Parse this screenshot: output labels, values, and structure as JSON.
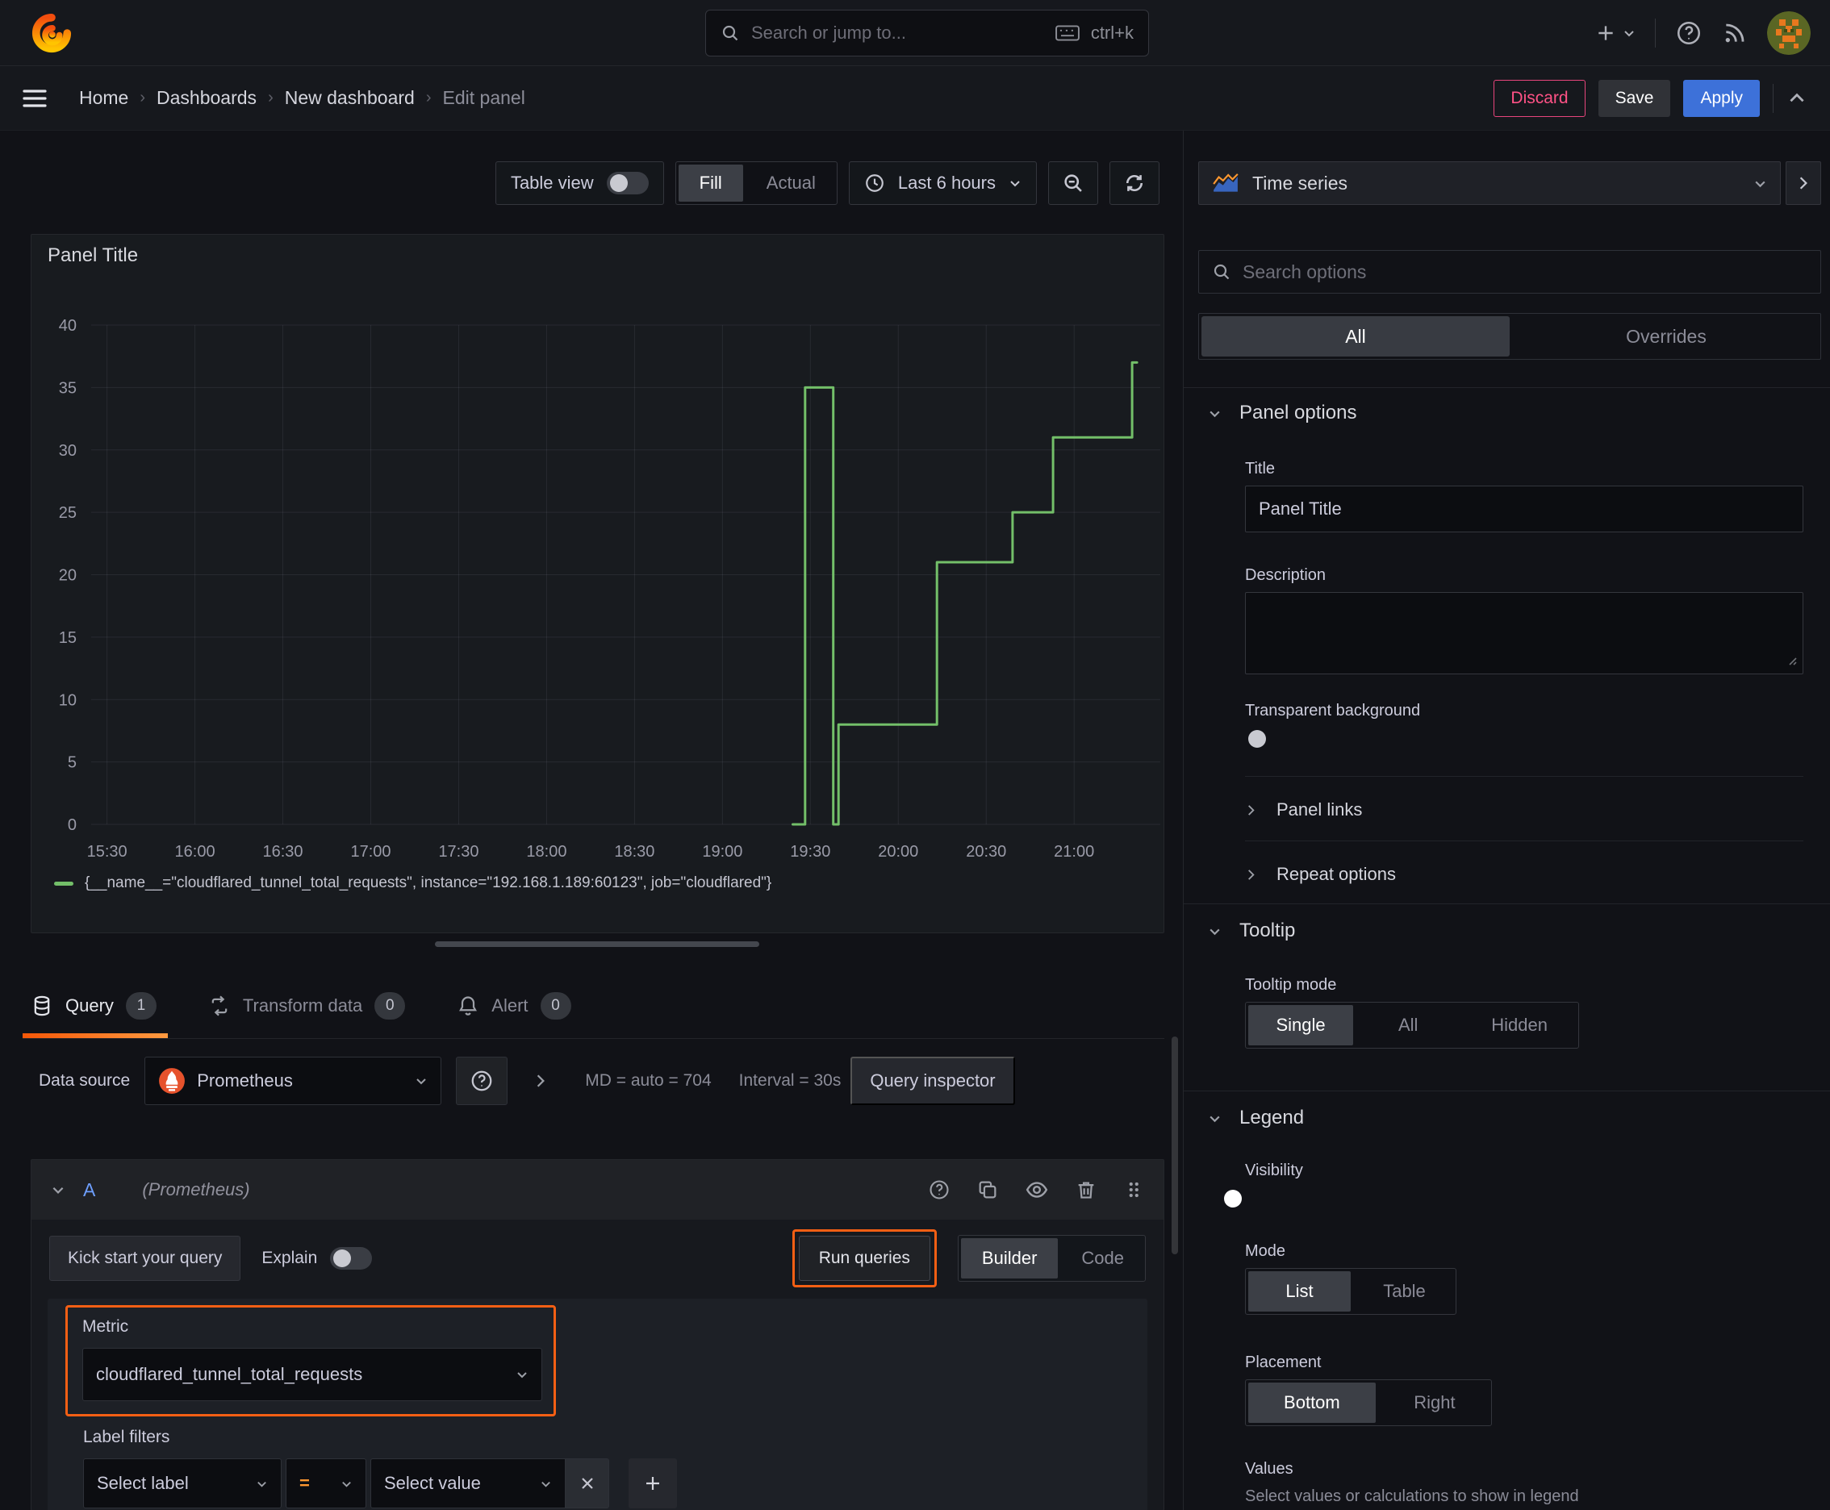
{
  "topbar": {
    "search_placeholder": "Search or jump to...",
    "shortcut": "ctrl+k"
  },
  "breadcrumb": {
    "items": [
      "Home",
      "Dashboards",
      "New dashboard",
      "Edit panel"
    ]
  },
  "actions": {
    "discard": "Discard",
    "save": "Save",
    "apply": "Apply"
  },
  "view_toolbar": {
    "table_view": "Table view",
    "fill": "Fill",
    "actual": "Actual",
    "time_range": "Last 6 hours"
  },
  "panel": {
    "title": "Panel Title"
  },
  "chart_data": {
    "type": "line",
    "line_style": "step-after",
    "title": "Panel Title",
    "grid": true,
    "legend_position": "bottom",
    "ylim": [
      0,
      40
    ],
    "y_ticks": [
      0,
      5,
      10,
      15,
      20,
      25,
      30,
      35,
      40
    ],
    "x_range_hours": [
      15.41,
      21.49
    ],
    "x_ticks": {
      "labels": [
        "15:30",
        "16:00",
        "16:30",
        "17:00",
        "17:30",
        "18:00",
        "18:30",
        "19:00",
        "19:30",
        "20:00",
        "20:30",
        "21:00"
      ],
      "hours": [
        15.5,
        16,
        16.5,
        17,
        17.5,
        18,
        18.5,
        19,
        19.5,
        20,
        20.5,
        21
      ]
    },
    "series": [
      {
        "name": "{__name__=\"cloudflared_tunnel_total_requests\", instance=\"192.168.1.189:60123\", job=\"cloudflared\"}",
        "color": "#73bf69",
        "point_times": [
          "19:24",
          "19:28",
          "19:38",
          "19:39",
          "20:13",
          "20:39",
          "20:53",
          "21:20"
        ],
        "points": [
          [
            19.4,
            0
          ],
          [
            19.47,
            35
          ],
          [
            19.63,
            0
          ],
          [
            19.66,
            8
          ],
          [
            20.22,
            21
          ],
          [
            20.65,
            25
          ],
          [
            20.88,
            31
          ],
          [
            21.33,
            37
          ]
        ]
      }
    ]
  },
  "tabs": {
    "query": {
      "label": "Query",
      "count": "1"
    },
    "transform": {
      "label": "Transform data",
      "count": "0"
    },
    "alert": {
      "label": "Alert",
      "count": "0"
    }
  },
  "query_bar": {
    "data_source_label": "Data source",
    "data_source": "Prometheus",
    "stats": "MD = auto = 704",
    "interval": "Interval = 30s",
    "inspector": "Query inspector"
  },
  "query_editor": {
    "ref_id": "A",
    "ds_hint": "(Prometheus)",
    "kick_start": "Kick start your query",
    "explain": "Explain",
    "run_queries": "Run queries",
    "builder": "Builder",
    "code": "Code",
    "metric_label": "Metric",
    "metric_value": "cloudflared_tunnel_total_requests",
    "label_filters_label": "Label filters",
    "select_label_placeholder": "Select label",
    "operator": "=",
    "select_value_placeholder": "Select value"
  },
  "options_pane": {
    "viz_type": "Time series",
    "search_placeholder": "Search options",
    "tab_all": "All",
    "tab_overrides": "Overrides",
    "panel_options": {
      "header": "Panel options",
      "title_label": "Title",
      "title_value": "Panel Title",
      "description_label": "Description",
      "description_value": "",
      "transparent_label": "Transparent background",
      "panel_links": "Panel links",
      "repeat_options": "Repeat options"
    },
    "tooltip": {
      "header": "Tooltip",
      "mode_label": "Tooltip mode",
      "options": [
        "Single",
        "All",
        "Hidden"
      ],
      "selected": "Single"
    },
    "legend": {
      "header": "Legend",
      "visibility_label": "Visibility",
      "mode_label": "Mode",
      "mode_options": [
        "List",
        "Table"
      ],
      "mode_selected": "List",
      "placement_label": "Placement",
      "placement_options": [
        "Bottom",
        "Right"
      ],
      "placement_selected": "Bottom",
      "values_label": "Values",
      "values_help": "Select values or calculations to show in legend"
    }
  },
  "colors": {
    "annotation_orange": "#f55f14",
    "tab_underline_from": "#f55708",
    "tab_underline_to": "#ff9a40",
    "series_green": "#73bf69",
    "primary_blue": "#3d71d9",
    "critical_pink": "#ff5286",
    "ref_id_blue": "#6e9fff",
    "operator_orange": "#ff9830"
  }
}
